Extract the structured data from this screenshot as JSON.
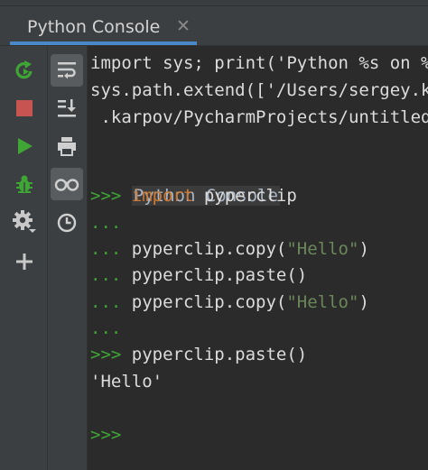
{
  "tab": {
    "title": "Python Console",
    "close": "✕"
  },
  "toolbar_left": [
    {
      "name": "rerun-icon"
    },
    {
      "name": "stop-icon"
    },
    {
      "name": "run-icon"
    },
    {
      "name": "debug-icon"
    },
    {
      "name": "settings-icon"
    },
    {
      "name": "add-icon"
    }
  ],
  "toolbar_right": [
    {
      "name": "soft-wrap-icon"
    },
    {
      "name": "scroll-to-end-icon"
    },
    {
      "name": "print-icon"
    },
    {
      "name": "show-variables-icon"
    },
    {
      "name": "history-icon"
    }
  ],
  "console": {
    "startup_1": "import sys; print('Python %s on %s' % (sys.version, sys.platform))",
    "startup_2": "sys.path.extend(['/Users/sergey.karpov/PycharmProjects/untitled'])",
    "startup_3": " .karpov/PycharmProjects/untitled",
    "label": "Python Console",
    "prompt_main": ">>>",
    "prompt_cont": "...",
    "l1_kw": "import",
    "l1_rest": " pyperclip",
    "l3_call": " pyperclip.copy(",
    "l3_str": "\"Hello\"",
    "l3_close": ")",
    "l4_call": " pyperclip.paste()",
    "l5_call": " pyperclip.copy(",
    "l5_str": "\"Hello\"",
    "l5_close": ")",
    "l7_call": " pyperclip.paste()",
    "output": "'Hello'"
  },
  "colors": {
    "green": "#3fa535",
    "red": "#c75450",
    "accent": "#4a88c7"
  }
}
